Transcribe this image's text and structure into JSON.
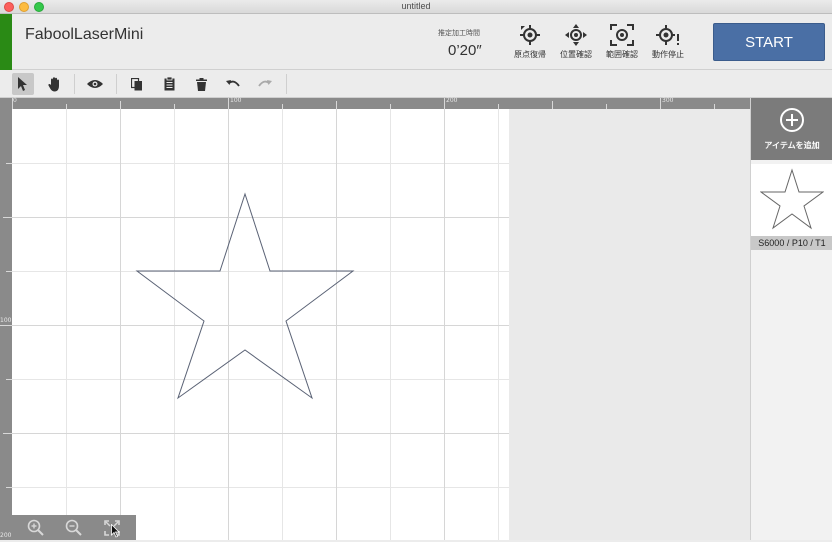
{
  "window": {
    "title": "untitled"
  },
  "header": {
    "app_name": "FaboolLaserMini",
    "est_label": "推定加工時間",
    "est_time": "0’20″",
    "buttons": [
      {
        "label": "原点復帰",
        "icon": "crosshair-origin-icon"
      },
      {
        "label": "位置確認",
        "icon": "crosshair-arrows-icon"
      },
      {
        "label": "範囲確認",
        "icon": "range-frame-icon"
      },
      {
        "label": "動作停止",
        "icon": "stop-crosshair-icon"
      }
    ],
    "start_label": "START"
  },
  "toolbar": {
    "tools": [
      "pointer-icon",
      "hand-icon",
      "eye-icon",
      "copy-icon",
      "paste-icon",
      "trash-icon",
      "undo-icon",
      "redo-icon"
    ]
  },
  "rulers": {
    "top": [
      "0",
      "100",
      "200",
      "300"
    ],
    "left": [
      "100",
      "200"
    ]
  },
  "right_panel": {
    "add_label": "アイテムを追加",
    "item_params": "S6000 / P10 / T1"
  },
  "colors": {
    "brand_green": "#2a8a15",
    "start_blue": "#4a6fa5",
    "star_stroke": "#5a6275"
  }
}
